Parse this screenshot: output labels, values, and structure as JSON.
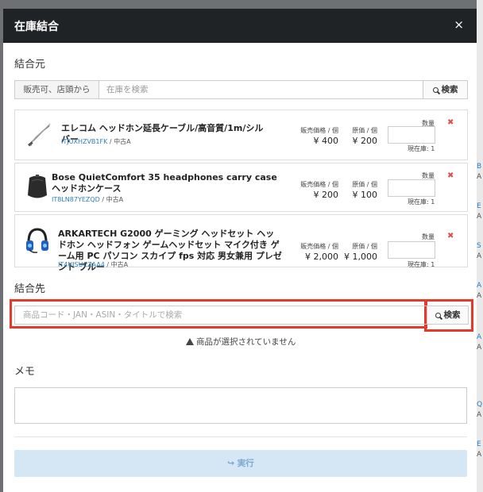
{
  "modal": {
    "title": "在庫結合",
    "close": "×"
  },
  "source": {
    "label": "結合元",
    "filter_label": "販売可、店頭から",
    "search_placeholder": "在庫を検索",
    "search_button": "検索"
  },
  "items": [
    {
      "name": "エレコム ヘッドホン延長ケーブル/高音質/1m/シルバー",
      "sku": "ITJUXHZVB1FK",
      "condition": "中古A",
      "sell_label": "販売価格 / 個",
      "sell_price": "¥ 400",
      "cost_label": "原価 / 個",
      "cost_price": "¥ 200",
      "qty_label": "数量",
      "stock": "現在庫: 1"
    },
    {
      "name": "Bose QuietComfort 35 headphones carry case ヘッドホンケース",
      "sku": "IT8LN87YEZQD",
      "condition": "中古A",
      "sell_label": "販売価格 / 個",
      "sell_price": "¥ 200",
      "cost_label": "原価 / 個",
      "cost_price": "¥ 100",
      "qty_label": "数量",
      "stock": "現在庫: 1"
    },
    {
      "name": "ARKARTECH G2000 ゲーミング ヘッドセット ヘッドホン ヘッドフォン ゲームヘッドセット マイク付き ゲーム用 PC パソコン スカイプ fps 対応 男女兼用 プレゼント ブルー",
      "sku": "IT4UJSUCZAA4",
      "condition": "中古A",
      "sell_label": "販売価格 / 個",
      "sell_price": "¥ 2,000",
      "cost_label": "原価 / 個",
      "cost_price": "¥ 1,000",
      "qty_label": "数量",
      "stock": "現在庫: 1"
    }
  ],
  "destination": {
    "label": "結合先",
    "search_placeholder": "商品コード・JAN・ASIN・タイトルで検索",
    "search_button": "検索",
    "warning": "商品が選択されていません"
  },
  "memo": {
    "label": "メモ"
  },
  "submit": {
    "label": "実行"
  },
  "colors": {
    "header": "#202326",
    "danger": "#d9534f",
    "highlight": "#e53a2b",
    "disabled_primary": "#d5e6f4"
  }
}
